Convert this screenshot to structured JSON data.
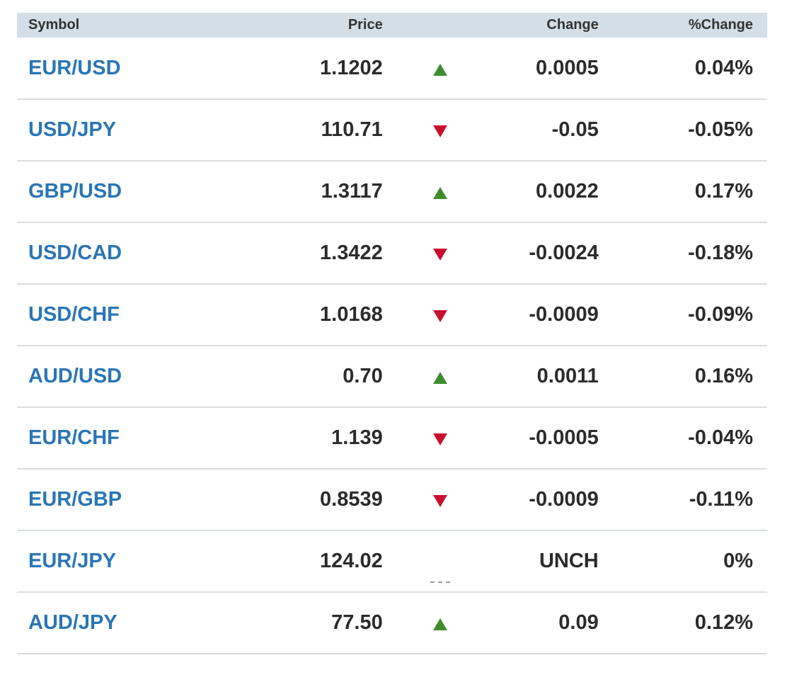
{
  "colors": {
    "header_bg": "#d3dee6",
    "symbol_link": "#2a76b5",
    "up": "#3f8c2f",
    "down": "#c8102e",
    "unch": "#9a9a9a"
  },
  "table": {
    "headers": {
      "symbol": "Symbol",
      "price": "Price",
      "change": "Change",
      "pct_change": "%Change"
    },
    "rows": [
      {
        "symbol": "EUR/USD",
        "price": "1.1202",
        "direction": "up",
        "change": "0.0005",
        "pct_change": "0.04%"
      },
      {
        "symbol": "USD/JPY",
        "price": "110.71",
        "direction": "down",
        "change": "-0.05",
        "pct_change": "-0.05%"
      },
      {
        "symbol": "GBP/USD",
        "price": "1.3117",
        "direction": "up",
        "change": "0.0022",
        "pct_change": "0.17%"
      },
      {
        "symbol": "USD/CAD",
        "price": "1.3422",
        "direction": "down",
        "change": "-0.0024",
        "pct_change": "-0.18%"
      },
      {
        "symbol": "USD/CHF",
        "price": "1.0168",
        "direction": "down",
        "change": "-0.0009",
        "pct_change": "-0.09%"
      },
      {
        "symbol": "AUD/USD",
        "price": "0.70",
        "direction": "up",
        "change": "0.0011",
        "pct_change": "0.16%"
      },
      {
        "symbol": "EUR/CHF",
        "price": "1.139",
        "direction": "down",
        "change": "-0.0005",
        "pct_change": "-0.04%"
      },
      {
        "symbol": "EUR/GBP",
        "price": "0.8539",
        "direction": "down",
        "change": "-0.0009",
        "pct_change": "-0.11%"
      },
      {
        "symbol": "EUR/JPY",
        "price": "124.02",
        "direction": "unch",
        "change": "UNCH",
        "pct_change": "0%"
      },
      {
        "symbol": "AUD/JPY",
        "price": "77.50",
        "direction": "up",
        "change": "0.09",
        "pct_change": "0.12%"
      }
    ]
  }
}
